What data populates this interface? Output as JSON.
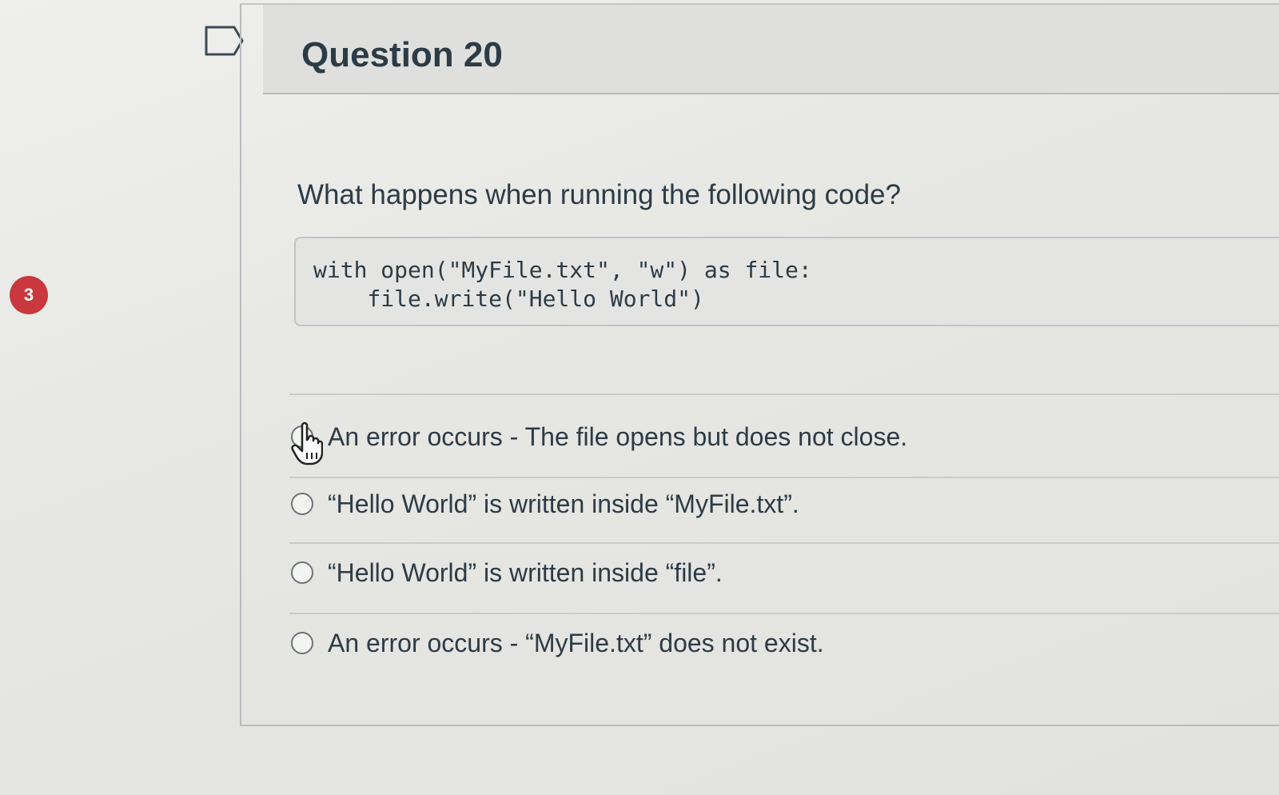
{
  "sidebar": {
    "badge_count": "3"
  },
  "question": {
    "title": "Question 20",
    "prompt": "What happens when running the following code?",
    "code_lines": [
      "with open(\"MyFile.txt\", \"w\") as file:",
      "    file.write(\"Hello World\")"
    ]
  },
  "answers": [
    {
      "label": "An error occurs - The file opens but does not close."
    },
    {
      "label": "“Hello World” is written inside “MyFile.txt”."
    },
    {
      "label": "“Hello World” is written inside “file”."
    },
    {
      "label": "An error occurs - “MyFile.txt” does not exist."
    }
  ],
  "icons": {
    "flag": "flag-outline-icon",
    "cursor": "hand-pointer-icon",
    "radio": "radio-unselected-icon"
  },
  "colors": {
    "badge": "#c8383c",
    "text": "#2d3b45",
    "code_background": "#e4e5e3"
  }
}
